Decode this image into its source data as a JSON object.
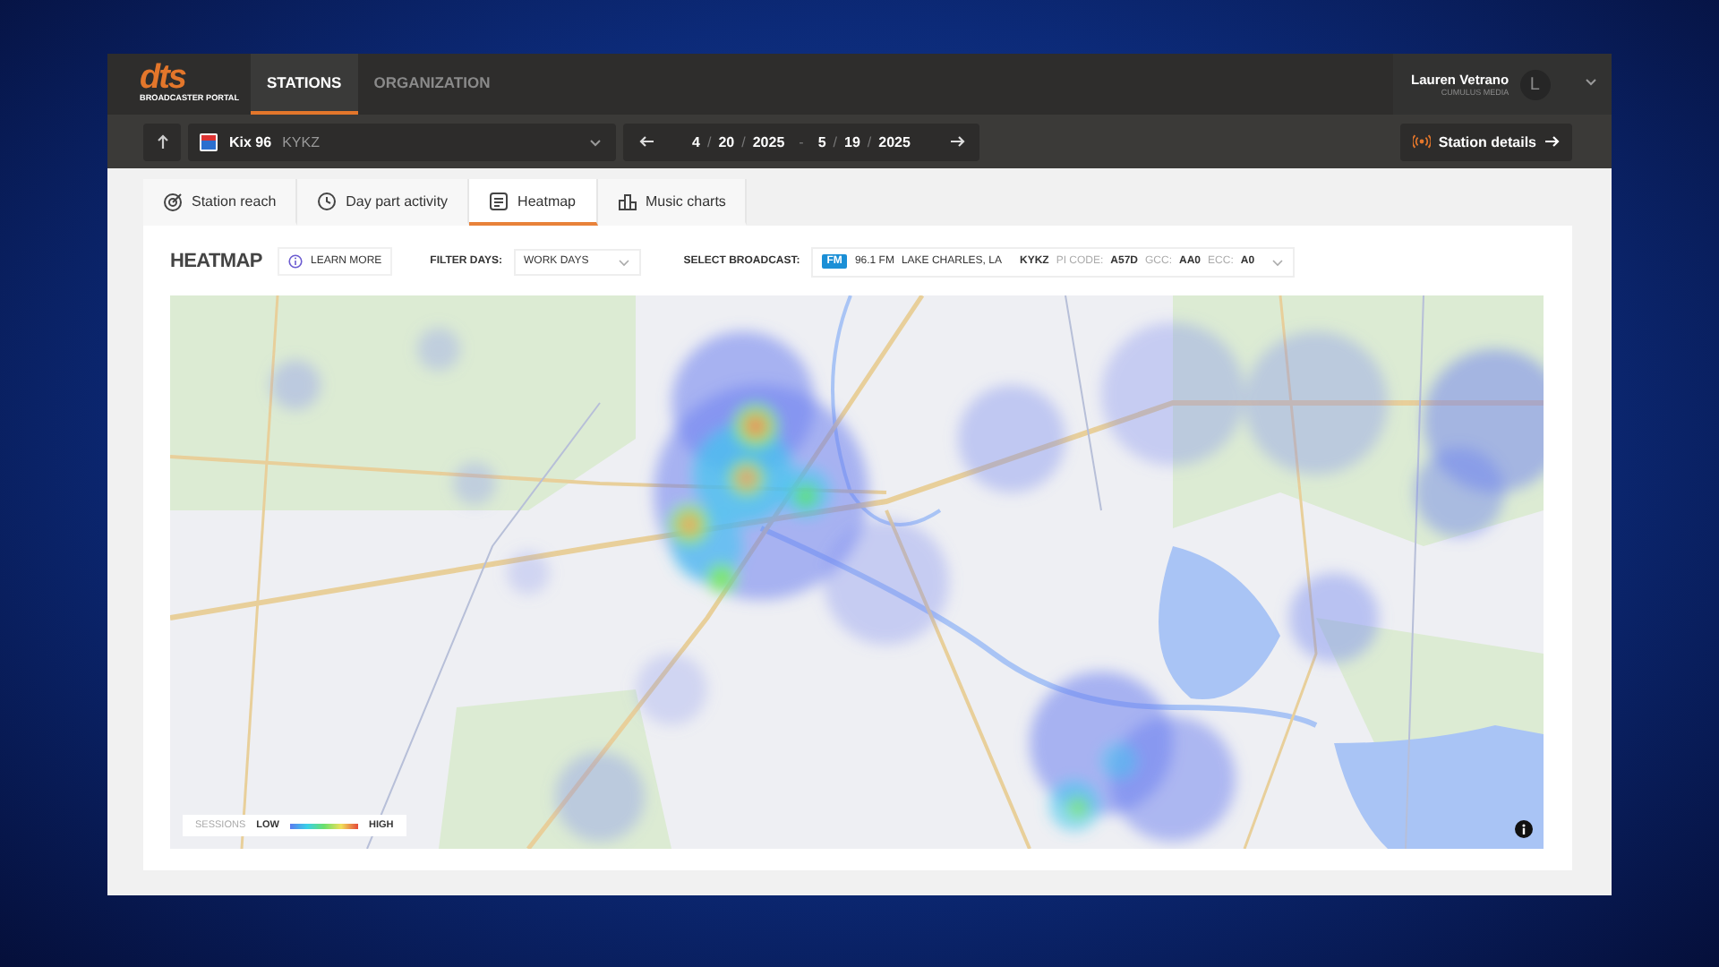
{
  "app": {
    "logo": "dts",
    "logo_subtitle": "BROADCASTER PORTAL",
    "nav": [
      {
        "label": "STATIONS",
        "selected": true
      },
      {
        "label": "ORGANIZATION",
        "selected": false
      }
    ],
    "user": {
      "name": "Lauren Vetrano",
      "org": "CUMULUS MEDIA",
      "initial": "L"
    }
  },
  "toolbar": {
    "station": {
      "name": "Kix 96",
      "call_sign": "KYKZ"
    },
    "date_range": {
      "start": {
        "month": "4",
        "day": "20",
        "year": "2025"
      },
      "end": {
        "month": "5",
        "day": "19",
        "year": "2025"
      },
      "date_separator": "/",
      "range_separator": "-"
    },
    "station_details": "Station details"
  },
  "tabs": [
    {
      "label": "Station reach",
      "kind": "reach",
      "selected": false
    },
    {
      "label": "Day part activity",
      "kind": "clock",
      "selected": false
    },
    {
      "label": "Heatmap",
      "kind": "heatmap",
      "selected": true
    },
    {
      "label": "Music charts",
      "kind": "music",
      "selected": false
    }
  ],
  "heatmap": {
    "title": "HEATMAP",
    "learn_more": "LEARN MORE",
    "filter_label": "FILTER DAYS:",
    "filter_value": "WORK DAYS",
    "broadcast_label": "SELECT BROADCAST:",
    "broadcast": {
      "band": "FM",
      "frequency": "96.1 FM",
      "city": "LAKE CHARLES, LA",
      "call_sign": "KYKZ",
      "pi_label": "PI CODE:",
      "pi_code": "A57D",
      "gcc_label": "GCC:",
      "gcc": "AA0",
      "ecc_label": "ECC:",
      "ecc": "A0"
    },
    "legend": {
      "label": "SESSIONS",
      "low": "LOW",
      "high": "HIGH"
    }
  }
}
